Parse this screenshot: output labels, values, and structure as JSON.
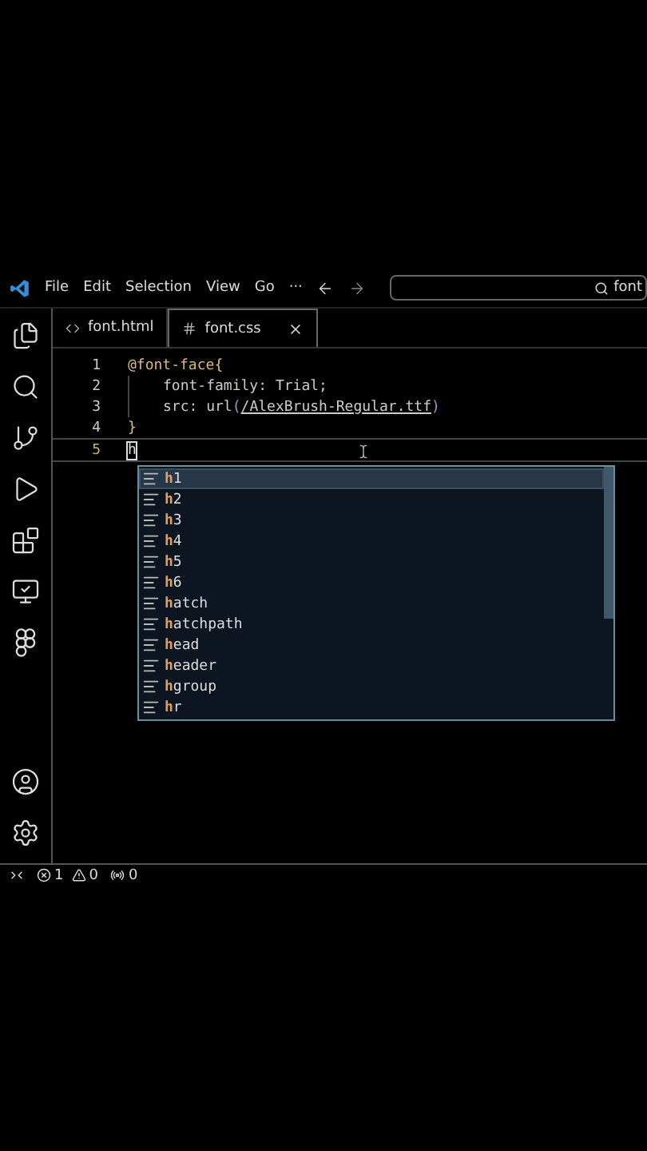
{
  "menu": [
    "File",
    "Edit",
    "Selection",
    "View",
    "Go",
    "···"
  ],
  "search": {
    "value": "font"
  },
  "tabs": [
    {
      "label": "font.html",
      "kind": "html",
      "selected": false
    },
    {
      "label": "font.css",
      "kind": "css",
      "selected": true
    }
  ],
  "lines": [
    {
      "number": "1",
      "active": false,
      "indent": false,
      "tokens": [
        {
          "kind": "at",
          "text": "@font-face"
        },
        {
          "kind": "brace",
          "text": "{"
        }
      ]
    },
    {
      "number": "2",
      "active": false,
      "indent": true,
      "tokens": [
        {
          "kind": "prop",
          "text": "font-family: Trial;"
        }
      ]
    },
    {
      "number": "3",
      "active": false,
      "indent": true,
      "tokens": [
        {
          "kind": "prop",
          "text": "src: url"
        },
        {
          "kind": "paren",
          "text": "("
        },
        {
          "kind": "link",
          "text": "/AlexBrush-Regular.ttf"
        },
        {
          "kind": "paren",
          "text": ")"
        }
      ]
    },
    {
      "number": "4",
      "active": false,
      "indent": false,
      "tokens": [
        {
          "kind": "brace",
          "text": "}"
        }
      ]
    },
    {
      "number": "5",
      "active": true,
      "indent": false,
      "tokens": [
        {
          "kind": "typed",
          "text": "h"
        }
      ]
    }
  ],
  "suggestions": [
    {
      "label": "**h**1",
      "selected": true
    },
    {
      "label": "**h**2",
      "selected": false
    },
    {
      "label": "**h**3",
      "selected": false
    },
    {
      "label": "**h**4",
      "selected": false
    },
    {
      "label": "**h**5",
      "selected": false
    },
    {
      "label": "**h**6",
      "selected": false
    },
    {
      "label": "**h**atch",
      "selected": false
    },
    {
      "label": "**h**atchpath",
      "selected": false
    },
    {
      "label": "**h**ead",
      "selected": false
    },
    {
      "label": "**h**eader",
      "selected": false
    },
    {
      "label": "**h**group",
      "selected": false
    },
    {
      "label": "**h**r",
      "selected": false
    }
  ],
  "status": {
    "errors": "1",
    "warnings": "0",
    "ports": "0"
  }
}
